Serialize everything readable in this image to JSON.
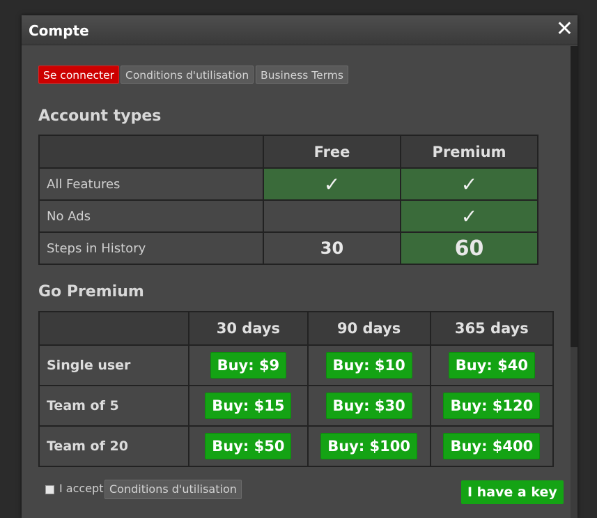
{
  "window": {
    "title": "Compte",
    "close_glyph": "✕"
  },
  "tabs": [
    {
      "label": "Se connecter",
      "active": true
    },
    {
      "label": "Conditions d'utilisation",
      "active": false
    },
    {
      "label": "Business Terms",
      "active": false
    }
  ],
  "account_types": {
    "heading": "Account types",
    "columns": [
      "",
      "Free",
      "Premium"
    ],
    "rows": [
      {
        "label": "All Features",
        "free": "✓",
        "premium": "✓"
      },
      {
        "label": "No Ads",
        "free": "",
        "premium": "✓"
      },
      {
        "label": "Steps in History",
        "free": "30",
        "premium": "60"
      }
    ]
  },
  "go_premium": {
    "heading": "Go Premium",
    "columns": [
      "",
      "30 days",
      "90 days",
      "365 days"
    ],
    "rows": [
      {
        "label": "Single user",
        "prices": [
          "Buy: $9",
          "Buy: $10",
          "Buy: $40"
        ]
      },
      {
        "label": "Team of 5",
        "prices": [
          "Buy: $15",
          "Buy: $30",
          "Buy: $120"
        ]
      },
      {
        "label": "Team of 20",
        "prices": [
          "Buy: $50",
          "Buy: $100",
          "Buy: $400"
        ]
      }
    ]
  },
  "footer": {
    "accept_label": "I accept",
    "terms_button": "Conditions d'utilisation",
    "key_button": "I have a key"
  },
  "colors": {
    "active_tab": "#cc0000",
    "premium_highlight": "#3a6b3a",
    "buy_button": "#14a314"
  }
}
